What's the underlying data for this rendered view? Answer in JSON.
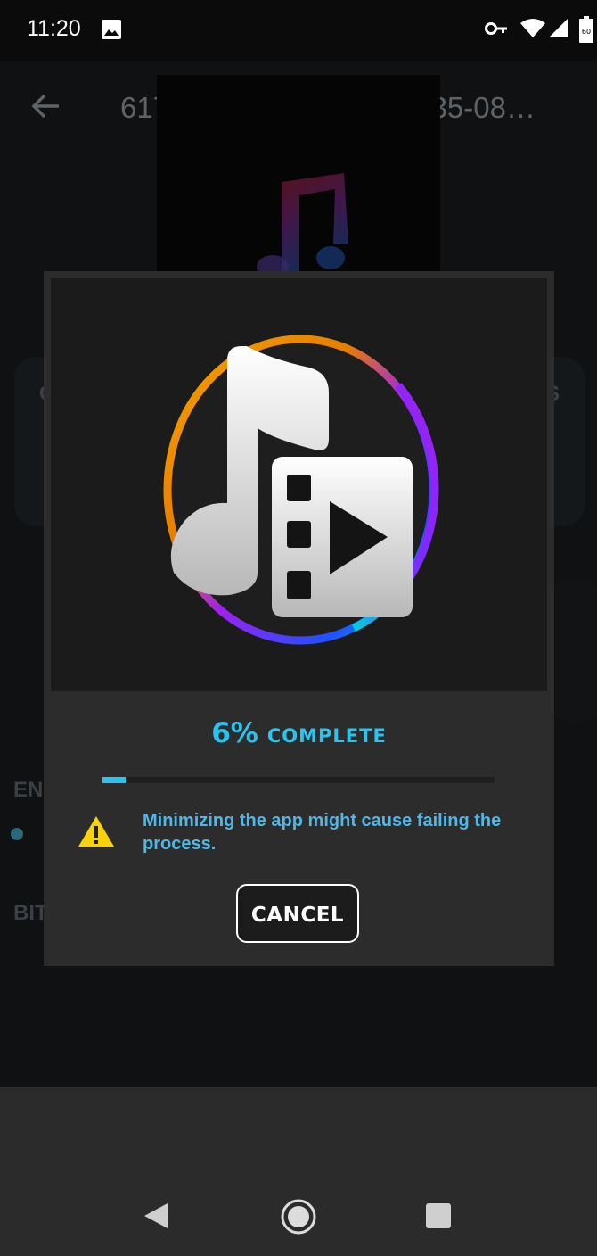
{
  "status_bar": {
    "time": "11:20",
    "battery_level": "60",
    "icons": [
      "image-icon",
      "vpn-key-icon",
      "wifi-icon",
      "signal-icon",
      "battery-icon"
    ]
  },
  "toolbar": {
    "title": "617c3cca-1b9a-46f9-9035-08…"
  },
  "background_labels": {
    "encoder_partial": "EN",
    "bitrate_partial": "BIT",
    "left_partial": "C",
    "right_partial": "S"
  },
  "dialog": {
    "progress_percent_text": "6%",
    "progress_label": "COMPLETE",
    "progress_value": 0.06,
    "warning_text": "Minimizing the app might cause failing the process.",
    "cancel_label": "CANCEL"
  },
  "colors": {
    "accent": "#29c5f0",
    "warning_yellow": "#f5d20a",
    "dialog_bg": "#2c2c2c"
  },
  "navigation": {
    "buttons": [
      "back",
      "home",
      "recents"
    ]
  }
}
